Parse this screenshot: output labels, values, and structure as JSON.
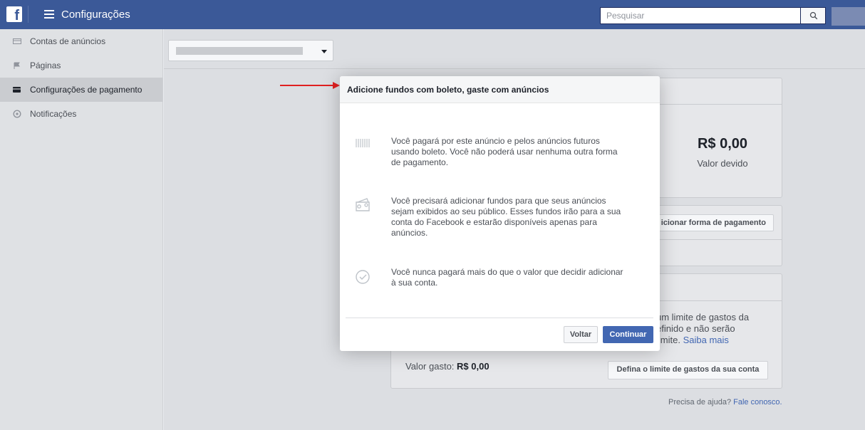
{
  "topbar": {
    "logo": "f",
    "title": "Configurações",
    "search_placeholder": "Pesquisar"
  },
  "sidebar": {
    "items": [
      {
        "label": "Contas de anúncios",
        "icon": "card-icon"
      },
      {
        "label": "Páginas",
        "icon": "flag-icon"
      },
      {
        "label": "Configurações de pagamento",
        "icon": "wallet-icon",
        "active": true
      },
      {
        "label": "Notificações",
        "icon": "globe-icon"
      }
    ]
  },
  "billing": {
    "amount_due": "R$ 0,00",
    "amount_due_label": "Valor devido",
    "add_payment_label": "icionar forma de pagamento",
    "limit_text_1": "um limite de gastos da",
    "limit_text_2": "efinido e não serão",
    "limit_text_3": "limite.",
    "learn_more": "Saiba mais",
    "spent_label": "Valor gasto:",
    "spent_value": "R$ 0,00",
    "set_limit_label": "Defina o limite de gastos da sua conta",
    "help_text": "Precisa de ajuda?",
    "contact_link": "Fale conosco."
  },
  "modal": {
    "title": "Adicione fundos com boleto, gaste com anúncios",
    "items": [
      {
        "icon": "barcode-icon",
        "text": "Você pagará por este anúncio e pelos anúncios futuros usando boleto. Você não poderá usar nenhuma outra forma de pagamento."
      },
      {
        "icon": "wallet-icon",
        "text": "Você precisará adicionar fundos para que seus anúncios sejam exibidos ao seu público. Esses fundos irão para a sua conta do Facebook e estarão disponíveis apenas para anúncios."
      },
      {
        "icon": "checkmark-circle-icon",
        "text": "Você nunca pagará mais do que o valor que decidir adicionar à sua conta."
      }
    ],
    "back_label": "Voltar",
    "continue_label": "Continuar"
  },
  "colors": {
    "brand": "#3b5998",
    "primary_button": "#4267b2",
    "annotation_arrow": "#e02020"
  }
}
